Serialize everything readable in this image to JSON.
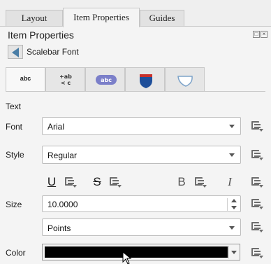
{
  "top_tabs": [
    {
      "label": "Layout"
    },
    {
      "label": "Item Properties"
    },
    {
      "label": "Guides"
    }
  ],
  "panel": {
    "title": "Item Properties",
    "item_name": "Scalebar Font"
  },
  "sub_tabs": [
    {
      "label": "abc",
      "icon": "text-tab-icon",
      "active": true
    },
    {
      "label": "+ab\n< c",
      "icon": "formatting-tab-icon"
    },
    {
      "label": "abc",
      "icon": "buffer-tab-icon"
    },
    {
      "label": "",
      "icon": "background-shield-tab-icon"
    },
    {
      "label": "",
      "icon": "shadow-tab-icon"
    }
  ],
  "text_section": {
    "section_label": "Text",
    "font_label": "Font",
    "font_value": "Arial",
    "style_label": "Style",
    "style_value": "Regular",
    "underline_glyph": "U",
    "strikeout_glyph": "S",
    "bold_glyph": "B",
    "italic_glyph": "I",
    "size_label": "Size",
    "size_value": "10.0000",
    "unit_value": "Points",
    "color_label": "Color",
    "color_value": "#000000"
  },
  "colors": {
    "accent": "#4a7ea6",
    "buffer_badge": "#7b7fc9",
    "shield_blue": "#1f4f9a",
    "shield_red": "#c8312b"
  }
}
